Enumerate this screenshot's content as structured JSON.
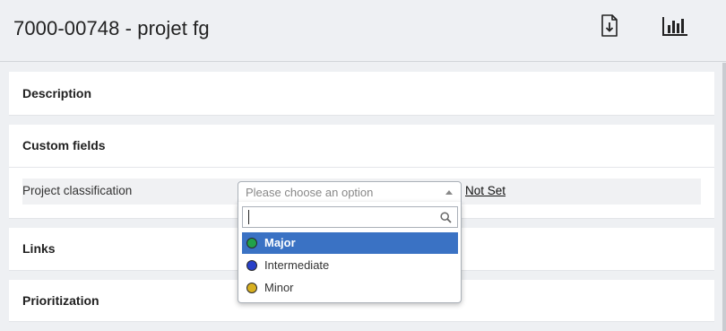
{
  "header": {
    "title": "7000-00748 - projet fg",
    "export_icon": "file-download-icon",
    "report_icon": "bar-chart-icon"
  },
  "panels": {
    "description": "Description",
    "custom_fields": "Custom fields",
    "links": "Links",
    "prioritization": "Prioritization"
  },
  "custom_field": {
    "label": "Project classification",
    "status": "Not Set",
    "select_placeholder": "Please choose an option",
    "search_value": "",
    "options": [
      {
        "label": "Major",
        "color": "#21a14a",
        "selected": true
      },
      {
        "label": "Intermediate",
        "color": "#2840c8",
        "selected": false
      },
      {
        "label": "Minor",
        "color": "#d8b020",
        "selected": false
      }
    ]
  },
  "colors": {
    "highlight": "#3a72c4",
    "background": "#eef0f3",
    "panel": "#ffffff"
  }
}
